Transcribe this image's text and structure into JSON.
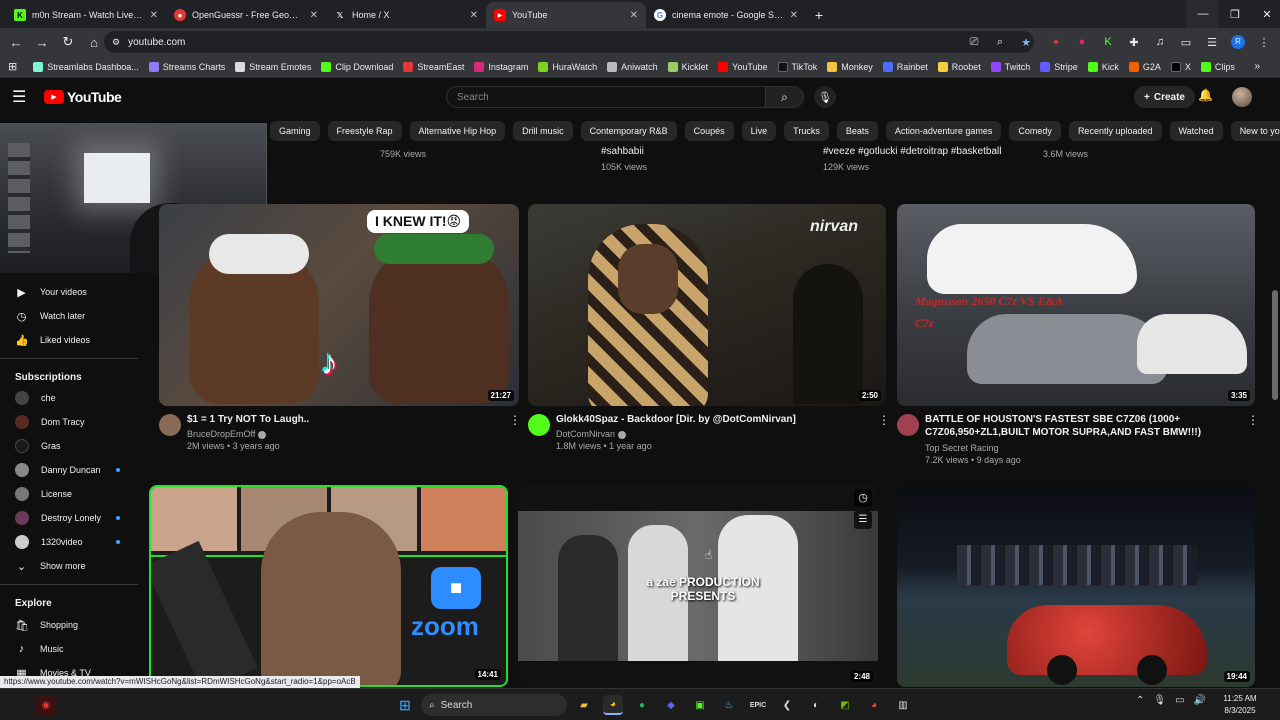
{
  "tabs": [
    {
      "title": "m0n Stream - Watch Live on Ki...",
      "color": "#53fc18",
      "glyph": "K"
    },
    {
      "title": "OpenGuessr - Free GeoGue...",
      "color": "#e53935",
      "glyph": "●"
    },
    {
      "title": "Home / X",
      "color": "#202124",
      "glyph": "𝕏"
    },
    {
      "title": "YouTube",
      "color": "#ff0000",
      "glyph": "▶"
    },
    {
      "title": "cinema emote - Google Search",
      "color": "#ffffff",
      "glyph": "G"
    }
  ],
  "omnibox": {
    "url": "youtube.com"
  },
  "bookmarks": [
    {
      "label": "Streamlabs Dashboa...",
      "color": "#80f5d2"
    },
    {
      "label": "Streams Charts",
      "color": "#8f7cf7"
    },
    {
      "label": "Stream Emotes",
      "color": "#dddddd"
    },
    {
      "label": "Clip Download",
      "color": "#53fc18"
    },
    {
      "label": "StreamEast",
      "color": "#e53935"
    },
    {
      "label": "Instagram",
      "color": "#d62976"
    },
    {
      "label": "HuraWatch",
      "color": "#7ed321"
    },
    {
      "label": "Aniwatch",
      "color": "#bbbbbb"
    },
    {
      "label": "Kicklet",
      "color": "#9ccc65"
    },
    {
      "label": "YouTube",
      "color": "#ff0000"
    },
    {
      "label": "TikTok",
      "color": "#111111"
    },
    {
      "label": "Monkey",
      "color": "#f5c542"
    },
    {
      "label": "Rainbet",
      "color": "#4a6cf7"
    },
    {
      "label": "Roobet",
      "color": "#f5d142"
    },
    {
      "label": "Twitch",
      "color": "#9146ff"
    },
    {
      "label": "Stripe",
      "color": "#635bff"
    },
    {
      "label": "Kick",
      "color": "#53fc18"
    },
    {
      "label": "G2A",
      "color": "#f05f00"
    },
    {
      "label": "X",
      "color": "#000000"
    },
    {
      "label": "Clips",
      "color": "#53fc18"
    }
  ],
  "youtube": {
    "logo_text": "YouTube",
    "search_placeholder": "Search",
    "create_label": "Create",
    "chips": [
      "Gaming",
      "Freestyle Rap",
      "Alternative Hip Hop",
      "Drill music",
      "Contemporary R&B",
      "Coupés",
      "Live",
      "Trucks",
      "Beats",
      "Action-adventure games",
      "Comedy",
      "Recently uploaded",
      "Watched",
      "New to you"
    ],
    "prev_row": {
      "c1_meta": "759K views",
      "c2_title": "#sahbabii",
      "c2_meta": "105K views",
      "c3_title": "#veeze #gotlucki #detroitrap #basketball",
      "c3_meta": "129K views",
      "c4_meta": "3.6M views"
    },
    "sidebar": {
      "top": [
        {
          "label": "Your videos",
          "icon": "▶"
        },
        {
          "label": "Watch later",
          "icon": "◷"
        },
        {
          "label": "Liked videos",
          "icon": "👍"
        }
      ],
      "subscriptions_head": "Subscriptions",
      "subscriptions": [
        {
          "label": "che",
          "color": "#444444",
          "dot": false
        },
        {
          "label": "Dom Tracy",
          "color": "#5a2a20",
          "dot": false
        },
        {
          "label": "Gras",
          "color": "#1a1a1a",
          "dot": false
        },
        {
          "label": "Danny Duncan",
          "color": "#888888",
          "dot": true
        },
        {
          "label": "License",
          "color": "#777777",
          "dot": false
        },
        {
          "label": "Destroy Lonely",
          "color": "#6a3a5a",
          "dot": true
        },
        {
          "label": "1320video",
          "color": "#cccccc",
          "dot": true
        }
      ],
      "show_more": "Show more",
      "explore_head": "Explore",
      "explore": [
        {
          "label": "Shopping",
          "icon": "🛍"
        },
        {
          "label": "Music",
          "icon": "♪"
        },
        {
          "label": "Movies & TV",
          "icon": "▦"
        }
      ]
    },
    "videos": [
      {
        "title": "$1 = 1 Try NOT To Laugh..",
        "channel": "BruceDropEmOff",
        "meta": "2M views • 3 years ago",
        "duration": "21:27",
        "thumb_text": "I KNEW IT!😡",
        "avatar": "#8a6b58"
      },
      {
        "title": "Glokk40Spaz - Backdoor [Dir. by @DotComNirvan]",
        "channel": "DotComNirvan",
        "meta": "1.8M views • 1 year ago",
        "duration": "2:50",
        "thumb_text": "nirvan",
        "avatar": "#53fc18"
      },
      {
        "title": "BATTLE OF HOUSTON'S FASTEST SBE C7Z06 (1000+ C7Z06,950+ZL1,BUILT MOTOR SUPRA,AND FAST BMW!!!)",
        "channel": "Top Secret Racing",
        "meta": "7.2K views • 9 days ago",
        "duration": "3:35",
        "thumb_text": "Magnuson 2650 C7z VS E&A C7z",
        "avatar": "#a04050"
      },
      {
        "duration": "14:41",
        "thumb_text": "zoom"
      },
      {
        "duration": "2:48",
        "thumb_text": "a zae PRODUCTION PRESENTS"
      },
      {
        "duration": "19:44",
        "thumb_text": ""
      }
    ]
  },
  "status_url": "https://www.youtube.com/watch?v=mWISHcGoNg&list=RDmWISHcGoNg&start_radio=1&pp=oAcB",
  "taskbar": {
    "search_label": "Search",
    "time": "11:25 AM",
    "date": "8/3/2025"
  }
}
